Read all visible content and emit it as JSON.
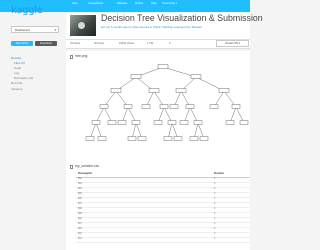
{
  "brand": {
    "logo": "kaggle",
    "accent": "#20beff",
    "link_color": "#1b9ad8"
  },
  "nav": {
    "items": [
      "Host",
      "Competitions",
      "Datasets",
      "Scripts",
      "Jobs",
      "Community ▾"
    ]
  },
  "sidebar": {
    "dashboard_select": "Dashboard",
    "new_script_label": "New Script",
    "download_label": "Download",
    "items": [
      {
        "label": "Results",
        "active": true
      },
      {
        "label": "Files (2)"
      },
      {
        "label": "Code"
      },
      {
        "label": "Log"
      },
      {
        "label": "Discussion (0)"
      },
      {
        "label": "Run Info"
      },
      {
        "label": "Versions"
      }
    ]
  },
  "script": {
    "title": "Decision Tree Visualization & Submission",
    "subtitle": "last run 5 months ago by Arias Ventura in Titanic: Machine Learning from Disaster",
    "stats": [
      "34 Votes",
      "66 Forks",
      "19002 Views",
      "1.75k",
      "0"
    ],
    "version_button": "Version 5/6",
    "version_icon": "chevron-down"
  },
  "files": {
    "image_file": "tree.png",
    "csv_file": "my_solution.csv"
  },
  "table": {
    "headers": [
      "PassengerId",
      "Survived"
    ],
    "rows": [
      [
        "892",
        "0"
      ],
      [
        "893",
        "0"
      ],
      [
        "894",
        "0"
      ],
      [
        "895",
        "0"
      ],
      [
        "896",
        "0"
      ],
      [
        "897",
        "0"
      ],
      [
        "898",
        "0"
      ],
      [
        "899",
        "0"
      ],
      [
        "900",
        "0"
      ],
      [
        "901",
        "0"
      ],
      [
        "902",
        "0"
      ],
      [
        "903",
        "0"
      ],
      [
        "904",
        "1"
      ]
    ]
  }
}
